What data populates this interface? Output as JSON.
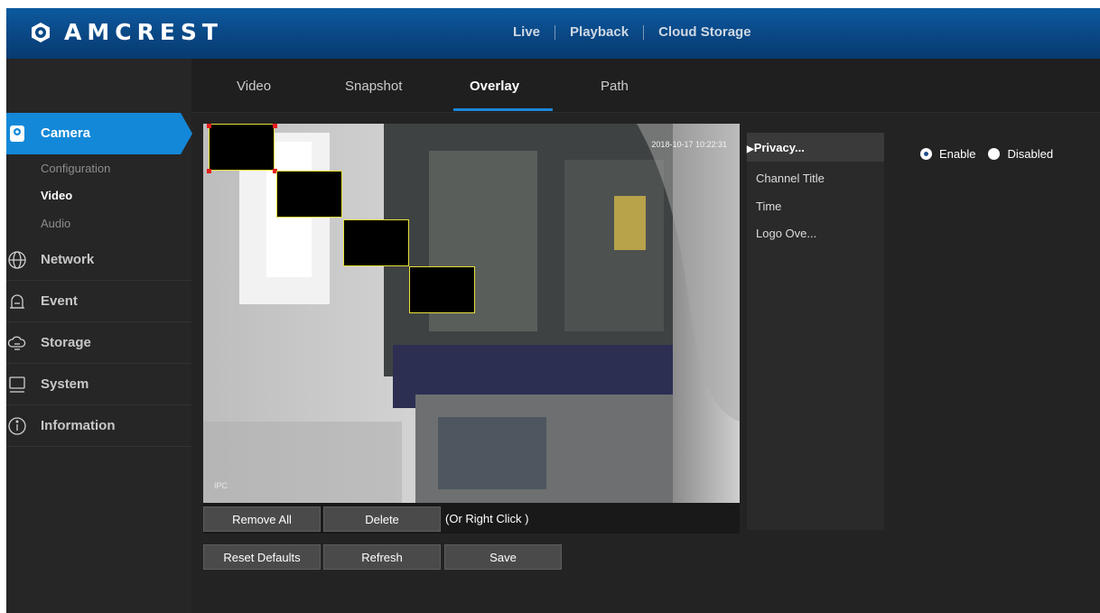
{
  "brand": {
    "name": "AMCREST"
  },
  "topnav": {
    "live": "Live",
    "playback": "Playback",
    "cloud": "Cloud Storage"
  },
  "tabs": {
    "video": "Video",
    "snapshot": "Snapshot",
    "overlay": "Overlay",
    "path": "Path"
  },
  "sidebar": {
    "camera": "Camera",
    "camera_sub": {
      "configuration": "Configuration",
      "video": "Video",
      "audio": "Audio"
    },
    "network": "Network",
    "event": "Event",
    "storage": "Storage",
    "system": "System",
    "information": "Information"
  },
  "video": {
    "timestamp": "2018-10-17 10:22:31",
    "channel_name": "IPC",
    "privacy_mask_count": 4
  },
  "video_buttons": {
    "remove_all": "Remove All",
    "delete": "Delete",
    "hint": "(Or Right Click )"
  },
  "actions": {
    "reset": "Reset Defaults",
    "refresh": "Refresh",
    "save": "Save"
  },
  "overlay_list": {
    "privacy": "Privacy...",
    "channel_title": "Channel Title",
    "time": "Time",
    "logo": "Logo Ove..."
  },
  "privacy_setting": {
    "enable": "Enable",
    "disabled": "Disabled",
    "selected": "Enable"
  },
  "colors": {
    "header": "#0a4886",
    "accent": "#1e86d6",
    "mask_border": "#e6e03a",
    "handle": "#e81c1c"
  }
}
